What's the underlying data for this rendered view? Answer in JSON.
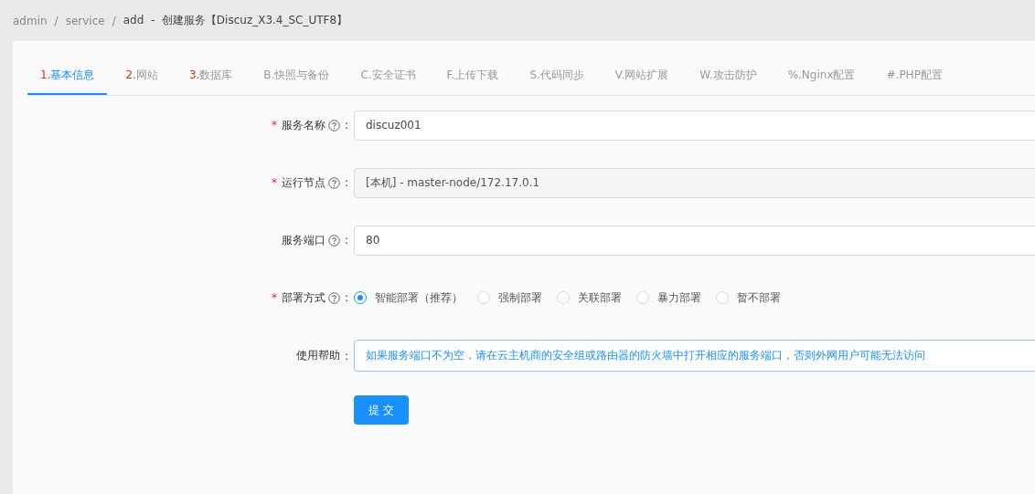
{
  "breadcrumb": [
    {
      "kind": "link",
      "text": "admin"
    },
    {
      "kind": "separator",
      "text": "/"
    },
    {
      "kind": "link",
      "text": "service"
    },
    {
      "kind": "separator",
      "text": "/"
    },
    {
      "kind": "current",
      "text": "add  -  创建服务【Discuz_X3.4_SC_UTF8】"
    }
  ],
  "tabs": [
    {
      "kind": "step",
      "prefix": "1.",
      "label": "基本信息",
      "selected": true
    },
    {
      "kind": "step",
      "prefix": "2.",
      "label": "网站",
      "selected": false
    },
    {
      "kind": "step",
      "prefix": "3.",
      "label": "数据库",
      "selected": false
    },
    {
      "kind": "extra",
      "prefix": "B.",
      "label": "快照与备份",
      "selected": false
    },
    {
      "kind": "extra",
      "prefix": "C.",
      "label": "安全证书",
      "selected": false
    },
    {
      "kind": "extra",
      "prefix": "F.",
      "label": "上传下载",
      "selected": false
    },
    {
      "kind": "extra",
      "prefix": "S.",
      "label": "代码同步",
      "selected": false
    },
    {
      "kind": "extra",
      "prefix": "V.",
      "label": "网站扩展",
      "selected": false
    },
    {
      "kind": "extra",
      "prefix": "W.",
      "label": "攻击防护",
      "selected": false
    },
    {
      "kind": "extra",
      "prefix": "%.",
      "label": "Nginx配置",
      "selected": false
    },
    {
      "kind": "extra",
      "prefix": "#.",
      "label": "PHP配置",
      "selected": false
    }
  ],
  "form": [
    {
      "kind": "input",
      "mark": "*",
      "label": "服务名称",
      "help": true,
      "colon": ":",
      "value": "discuz001",
      "disabled": false
    },
    {
      "kind": "input",
      "mark": "*",
      "label": "运行节点",
      "help": true,
      "colon": ":",
      "value": "[本机] - master-node/172.17.0.1",
      "disabled": true
    },
    {
      "kind": "input",
      "label": "服务端口",
      "help": true,
      "colon": ":",
      "value": "80",
      "disabled": false
    },
    {
      "kind": "radio",
      "mark": "*",
      "label": "部署方式",
      "help": true,
      "colon": ":",
      "options": [
        {
          "label": "智能部署（推荐）",
          "selected": true
        },
        {
          "label": "强制部署",
          "selected": false
        },
        {
          "label": "关联部署",
          "selected": false
        },
        {
          "label": "暴力部署",
          "selected": false
        },
        {
          "label": "暂不部署",
          "selected": false
        }
      ]
    },
    {
      "kind": "alert",
      "label": "使用帮助",
      "help": false,
      "colon": ":",
      "text": "如果服务端口不为空，请在云主机商的安全组或路由器的防火墙中打开相应的服务端口，否则外网用户可能无法访问"
    }
  ],
  "submit": "提 交"
}
